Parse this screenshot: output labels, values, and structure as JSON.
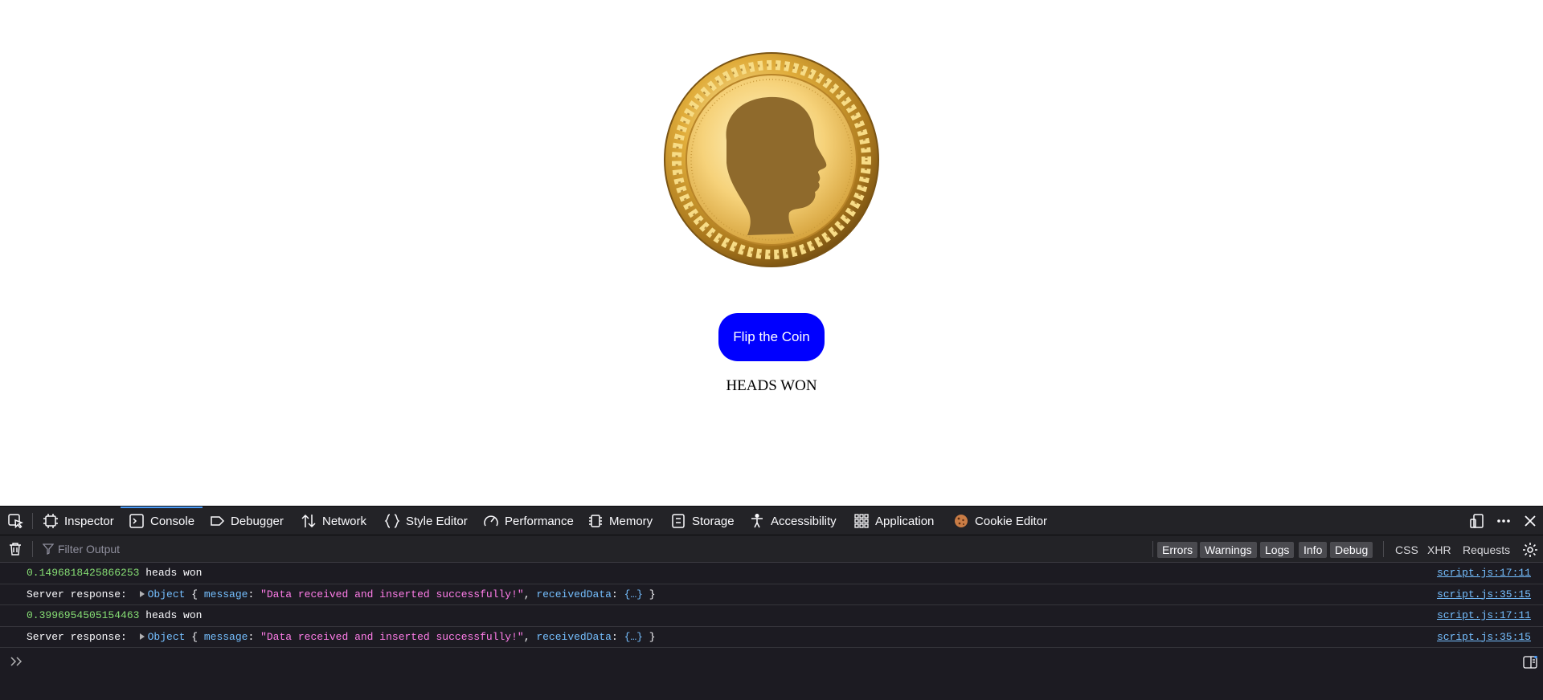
{
  "page": {
    "coin_alt": "coin heads",
    "flip_button_label": "Flip the Coin",
    "result_text": "HEADS WON"
  },
  "devtools": {
    "tabs": [
      {
        "label": "Inspector",
        "icon": "inspector-icon"
      },
      {
        "label": "Console",
        "icon": "console-icon",
        "selected": true
      },
      {
        "label": "Debugger",
        "icon": "debugger-icon"
      },
      {
        "label": "Network",
        "icon": "network-icon"
      },
      {
        "label": "Style Editor",
        "icon": "braces-icon"
      },
      {
        "label": "Performance",
        "icon": "gauge-icon"
      },
      {
        "label": "Memory",
        "icon": "chip-icon"
      },
      {
        "label": "Storage",
        "icon": "storage-icon"
      },
      {
        "label": "Accessibility",
        "icon": "accessibility-icon"
      },
      {
        "label": "Application",
        "icon": "grid-icon"
      },
      {
        "label": "Cookie Editor",
        "icon": "cookie-icon"
      }
    ],
    "filter": {
      "placeholder": "Filter Output",
      "levels": [
        "Errors",
        "Warnings",
        "Logs",
        "Info",
        "Debug"
      ],
      "extra": [
        "CSS",
        "XHR",
        "Requests"
      ]
    },
    "logs": [
      {
        "number": "0.1496818425866253",
        "text": " heads won",
        "source": "script.js:17:11"
      },
      {
        "prefix": "Server response: ",
        "object_label": "Object",
        "open": " { ",
        "key1": "message",
        "value1": "\"Data received and inserted successfully!\"",
        "key2": "receivedData",
        "value2": "{…}",
        "close": " }",
        "source": "script.js:35:15"
      },
      {
        "number": "0.3996954505154463",
        "text": " heads won",
        "source": "script.js:17:11"
      },
      {
        "prefix": "Server response: ",
        "object_label": "Object",
        "open": " { ",
        "key1": "message",
        "value1": "\"Data received and inserted successfully!\"",
        "key2": "receivedData",
        "value2": "{…}",
        "close": " }",
        "source": "script.js:35:15"
      }
    ]
  },
  "colors": {
    "button_blue": "#0000ff",
    "devtools_bg": "#1c1b22",
    "toolbar_bg": "#232327",
    "accent": "#4b9bf7",
    "number_green": "#86de74",
    "string_pink": "#ff7de9",
    "link_blue": "#75bfff",
    "coin_gold": "#e8b84a",
    "silhouette_brown": "#8f6a2c"
  }
}
